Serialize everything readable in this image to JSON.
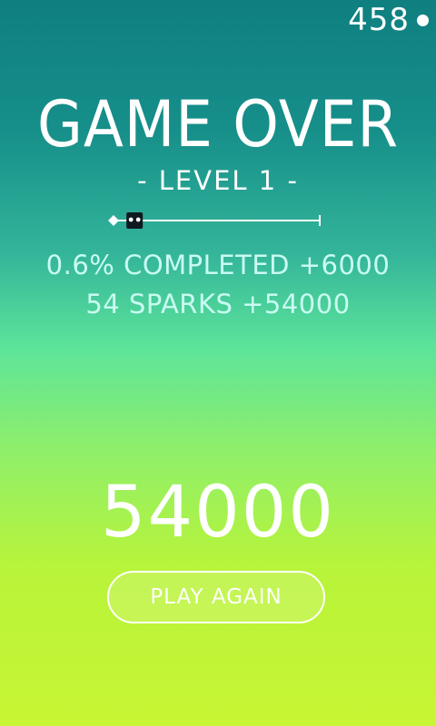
{
  "hud": {
    "sparks_count": "458",
    "spark_icon": "spark-dot-icon"
  },
  "title": "GAME OVER",
  "level_label": "- LEVEL 1 -",
  "progress": {
    "completed_fraction": 0.006
  },
  "stats": {
    "completed": "0.6% COMPLETED +6000",
    "sparks": "54 SPARKS +54000"
  },
  "score": "54000",
  "play_again_label": "PLAY AGAIN",
  "colors": {
    "bg_top": "#0f7f80",
    "bg_middle": "#5de49a",
    "bg_bottom": "#c8f534",
    "stat_text": "#c9fbf1",
    "text": "#ffffff"
  }
}
